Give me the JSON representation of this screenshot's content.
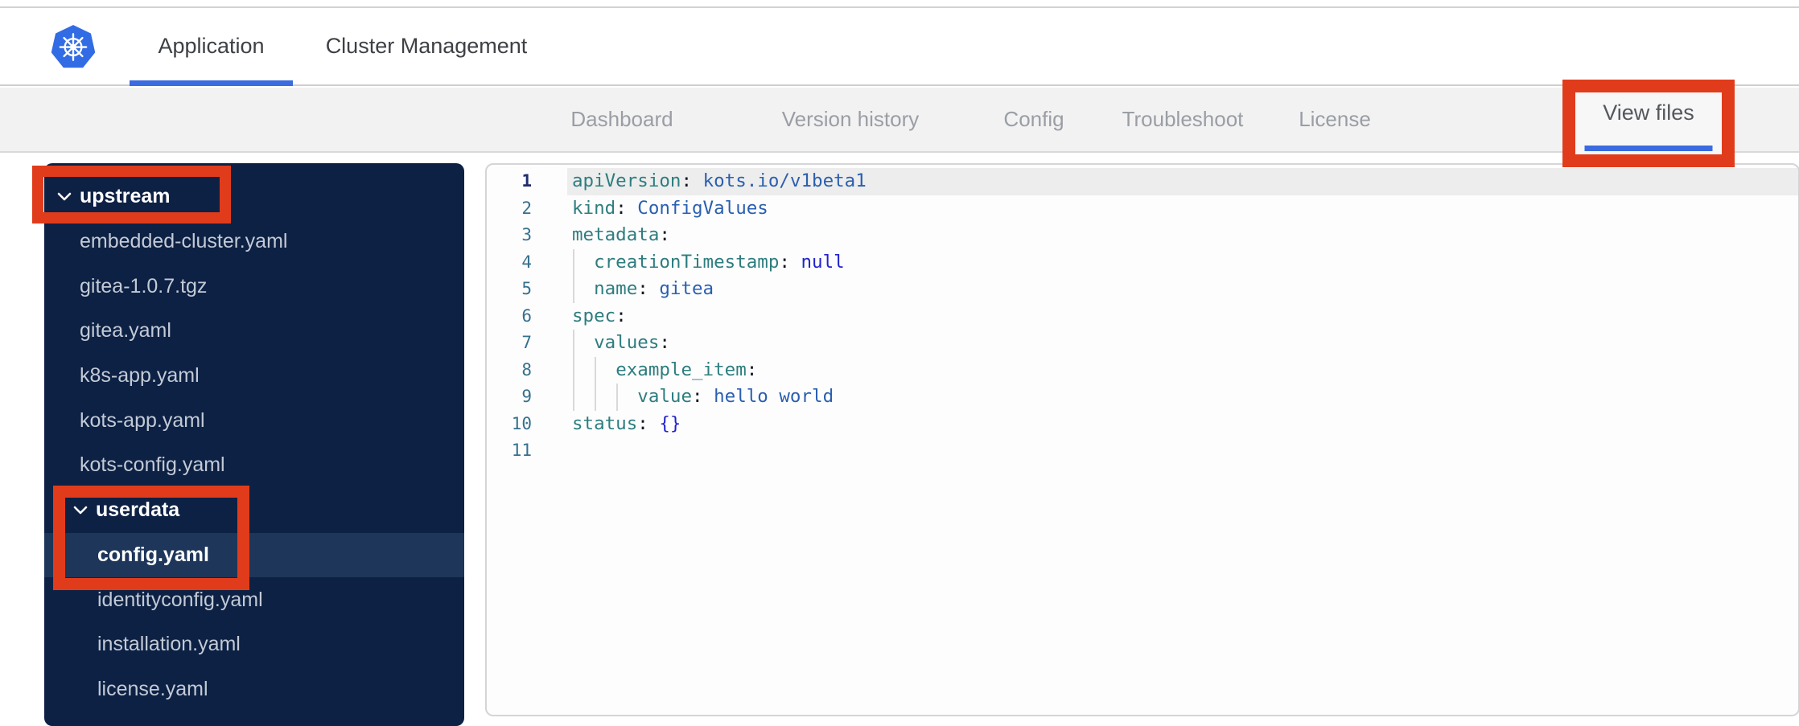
{
  "header": {
    "logo": "kubernetes-logo",
    "tabs": [
      {
        "label": "Application",
        "active": true
      },
      {
        "label": "Cluster Management",
        "active": false
      }
    ]
  },
  "subnav": {
    "items": [
      {
        "label": "Dashboard",
        "active": false
      },
      {
        "label": "Version history",
        "active": false
      },
      {
        "label": "Config",
        "active": false
      },
      {
        "label": "Troubleshoot",
        "active": false
      },
      {
        "label": "License",
        "active": false
      },
      {
        "label": "View files",
        "active": true,
        "annotated": true
      }
    ]
  },
  "file_tree": {
    "items": [
      {
        "label": "upstream",
        "type": "folder",
        "level": 1,
        "expanded": true,
        "annotated": true
      },
      {
        "label": "embedded-cluster.yaml",
        "type": "file",
        "level": 2
      },
      {
        "label": "gitea-1.0.7.tgz",
        "type": "file",
        "level": 2
      },
      {
        "label": "gitea.yaml",
        "type": "file",
        "level": 2
      },
      {
        "label": "k8s-app.yaml",
        "type": "file",
        "level": 2
      },
      {
        "label": "kots-app.yaml",
        "type": "file",
        "level": 2
      },
      {
        "label": "kots-config.yaml",
        "type": "file",
        "level": 2
      },
      {
        "label": "userdata",
        "type": "folder",
        "level": 2,
        "expanded": true,
        "annotated": true
      },
      {
        "label": "config.yaml",
        "type": "file",
        "level": 3,
        "selected": true,
        "annotated": true
      },
      {
        "label": "identityconfig.yaml",
        "type": "file",
        "level": 3
      },
      {
        "label": "installation.yaml",
        "type": "file",
        "level": 3
      },
      {
        "label": "license.yaml",
        "type": "file",
        "level": 3
      }
    ]
  },
  "editor": {
    "language": "yaml",
    "active_line": 1,
    "lines": [
      {
        "num": "1",
        "tokens": [
          [
            "key",
            "apiVersion"
          ],
          [
            "pun",
            ": "
          ],
          [
            "val",
            "kots.io/v1beta1"
          ]
        ]
      },
      {
        "num": "2",
        "tokens": [
          [
            "key",
            "kind"
          ],
          [
            "pun",
            ": "
          ],
          [
            "val",
            "ConfigValues"
          ]
        ]
      },
      {
        "num": "3",
        "tokens": [
          [
            "key",
            "metadata"
          ],
          [
            "pun",
            ":"
          ]
        ]
      },
      {
        "num": "4",
        "tokens": [
          [
            "ws",
            "  "
          ],
          [
            "key",
            "creationTimestamp"
          ],
          [
            "pun",
            ": "
          ],
          [
            "const",
            "null"
          ]
        ]
      },
      {
        "num": "5",
        "tokens": [
          [
            "ws",
            "  "
          ],
          [
            "key",
            "name"
          ],
          [
            "pun",
            ": "
          ],
          [
            "val",
            "gitea"
          ]
        ]
      },
      {
        "num": "6",
        "tokens": [
          [
            "key",
            "spec"
          ],
          [
            "pun",
            ":"
          ]
        ]
      },
      {
        "num": "7",
        "tokens": [
          [
            "ws",
            "  "
          ],
          [
            "key",
            "values"
          ],
          [
            "pun",
            ":"
          ]
        ]
      },
      {
        "num": "8",
        "tokens": [
          [
            "ws",
            "    "
          ],
          [
            "key",
            "example_item"
          ],
          [
            "pun",
            ":"
          ]
        ]
      },
      {
        "num": "9",
        "tokens": [
          [
            "ws",
            "      "
          ],
          [
            "key",
            "value"
          ],
          [
            "pun",
            ": "
          ],
          [
            "val",
            "hello world"
          ]
        ]
      },
      {
        "num": "10",
        "tokens": [
          [
            "key",
            "status"
          ],
          [
            "pun",
            ": "
          ],
          [
            "const",
            "{}"
          ]
        ]
      },
      {
        "num": "11",
        "tokens": []
      }
    ]
  },
  "annotations": {
    "color": "#e03c1c",
    "highlighted": [
      "upstream folder",
      "userdata / config.yaml",
      "View files tab"
    ]
  },
  "colors": {
    "accent_blue": "#3a6be0",
    "kubernetes_blue": "#326ce5",
    "sidebar_bg": "#0d2144",
    "sidebar_selected": "#1e3659",
    "yaml_key": "#2e7d7f",
    "yaml_value": "#2a5faf",
    "yaml_constant": "#2222cc"
  }
}
